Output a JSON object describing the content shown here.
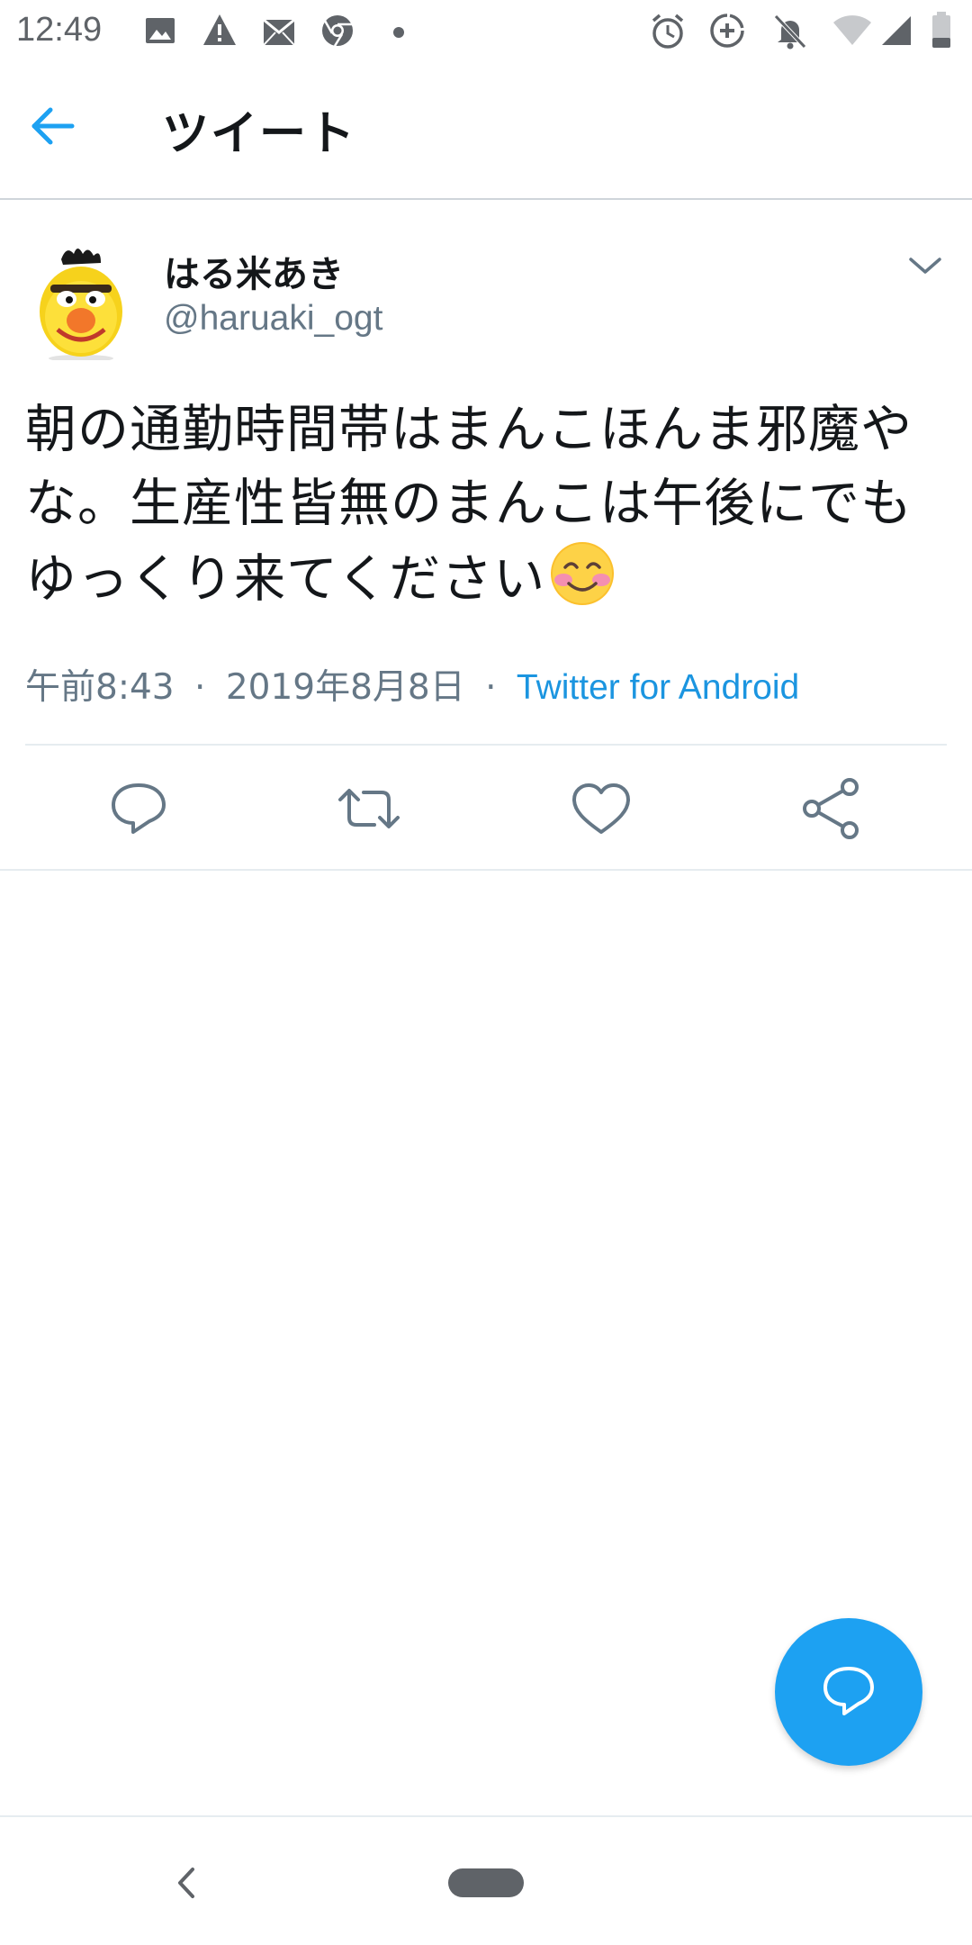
{
  "status_bar": {
    "time": "12:49",
    "left_icons": [
      "image-icon",
      "warning-icon",
      "mail-icon",
      "chrome-icon",
      "dot-icon"
    ],
    "right_icons": [
      "alarm-icon",
      "data-saver-icon",
      "bell-off-icon",
      "wifi-icon",
      "signal-icon",
      "battery-icon"
    ]
  },
  "header": {
    "back_icon": "arrow-left-icon",
    "title": "ツイート"
  },
  "tweet": {
    "display_name": "はる米あき",
    "handle": "@haruaki_ogt",
    "text": "朝の通勤時間帯はまんこほんま邪魔やな。生産性皆無のまんこは午後にでもゆっくり来てください",
    "emoji": "smiling-face-with-blush-icon",
    "time": "午前8:43",
    "separator": "·",
    "date": "2019年8月8日",
    "source": "Twitter for Android"
  },
  "actions": [
    "reply-icon",
    "retweet-icon",
    "like-icon",
    "share-icon"
  ],
  "fab": {
    "icon": "compose-reply-icon"
  },
  "nav_bar": {
    "back_icon": "nav-back-icon",
    "home_icon": "nav-home-pill"
  },
  "colors": {
    "accent": "#1da1f2",
    "link": "#1b95e0",
    "secondary_text": "#657786",
    "divider": "#e6ecf0"
  }
}
